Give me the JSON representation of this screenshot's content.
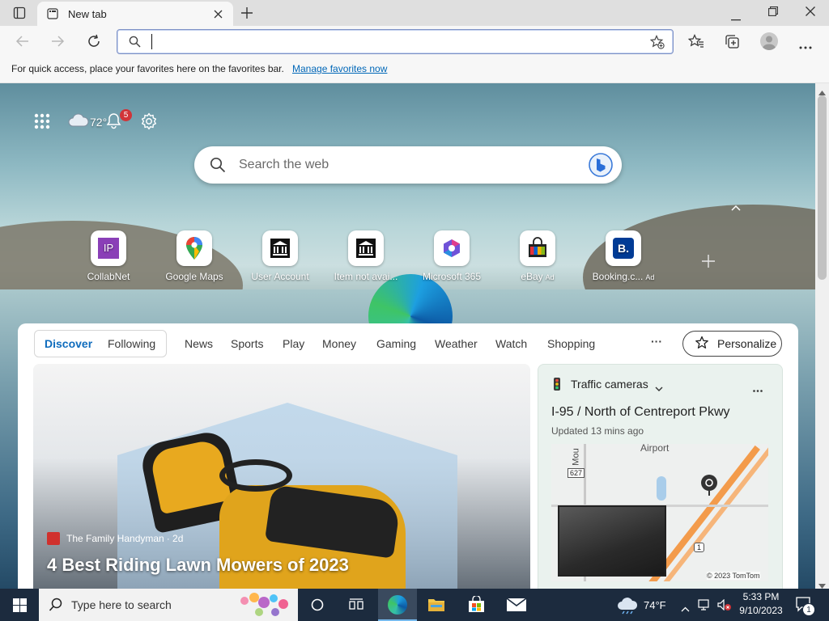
{
  "browser": {
    "tab_title": "New tab",
    "address_value": "",
    "favorites_message": "For quick access, place your favorites here on the favorites bar.",
    "manage_favorites_link": "Manage favorites now"
  },
  "newtab": {
    "weather_temp": "72°",
    "notification_count": "5",
    "search_placeholder": "Search the web",
    "quick_links": [
      {
        "label": "CollabNet",
        "ad": ""
      },
      {
        "label": "Google Maps",
        "ad": ""
      },
      {
        "label": "User Account",
        "ad": ""
      },
      {
        "label": "Item not avai...",
        "ad": ""
      },
      {
        "label": "Microsoft 365",
        "ad": ""
      },
      {
        "label": "eBay",
        "ad": "Ad"
      },
      {
        "label": "Booking.c...",
        "ad": "Ad"
      }
    ],
    "feed_tabs": {
      "discover": "Discover",
      "following": "Following",
      "items": [
        "News",
        "Sports",
        "Play",
        "Money",
        "Gaming",
        "Weather",
        "Watch",
        "Shopping"
      ],
      "more": "···",
      "personalize": "Personalize"
    },
    "main_article": {
      "source": "The Family Handyman",
      "age": "· 2d",
      "title": "4 Best Riding Lawn Mowers of 2023"
    },
    "traffic": {
      "header": "Traffic cameras",
      "location": "I-95 / North of Centreport Pkwy",
      "updated": "Updated 13 mins ago",
      "map_label_airport": "Airport",
      "map_label_mou": "Mou",
      "map_road_627": "627",
      "map_road_1": "1",
      "copyright": "© 2023 TomTom"
    }
  },
  "taskbar": {
    "search_placeholder": "Type here to search",
    "weather": "74°F",
    "time": "5:33 PM",
    "date": "9/10/2023",
    "notification_count": "1"
  },
  "colors": {
    "accent": "#0f6cbd",
    "link": "#0067b8",
    "taskbar_bg": "#1c2b3e",
    "badge_red": "#d13438"
  }
}
